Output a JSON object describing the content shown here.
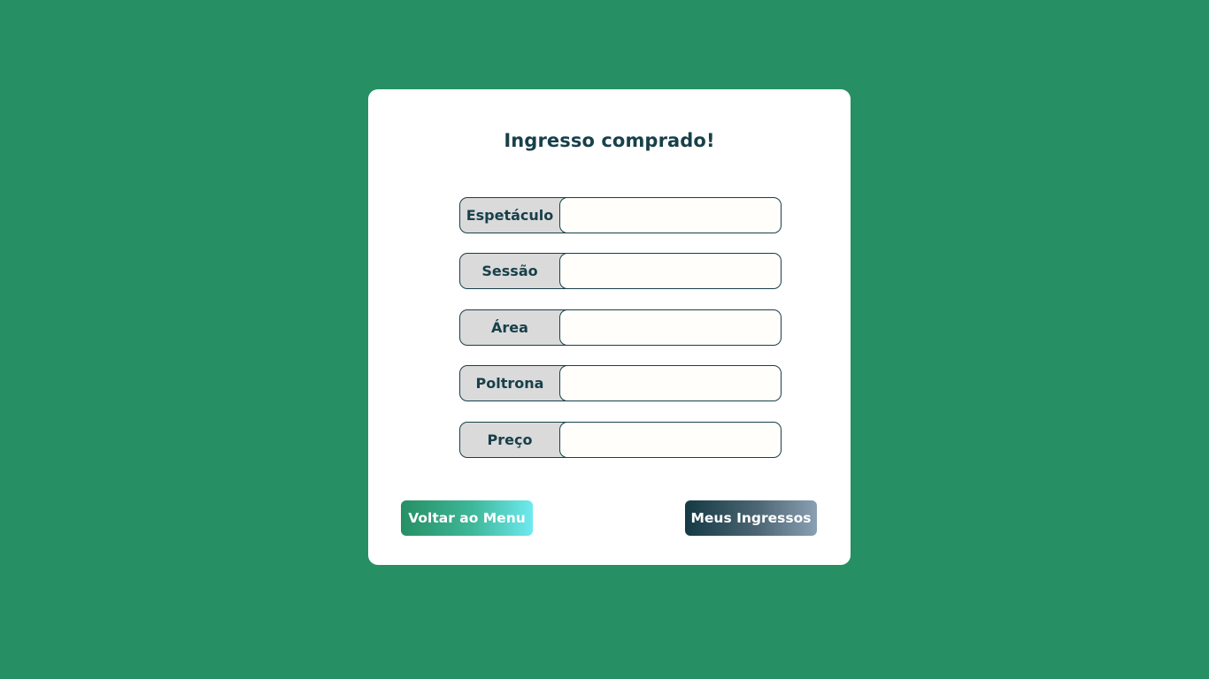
{
  "card": {
    "title": "Ingresso comprado!"
  },
  "fields": [
    {
      "label": "Espetáculo",
      "value": ""
    },
    {
      "label": "Sessão",
      "value": ""
    },
    {
      "label": "Área",
      "value": ""
    },
    {
      "label": "Poltrona",
      "value": ""
    },
    {
      "label": "Preço",
      "value": ""
    }
  ],
  "buttons": {
    "back_label": "Voltar ao Menu",
    "tickets_label": "Meus Ingressos"
  },
  "colors": {
    "background": "#268f64",
    "card": "#ffffff",
    "text_primary": "#18404a",
    "label_bg": "#dadada",
    "input_bg": "#fffefb"
  }
}
